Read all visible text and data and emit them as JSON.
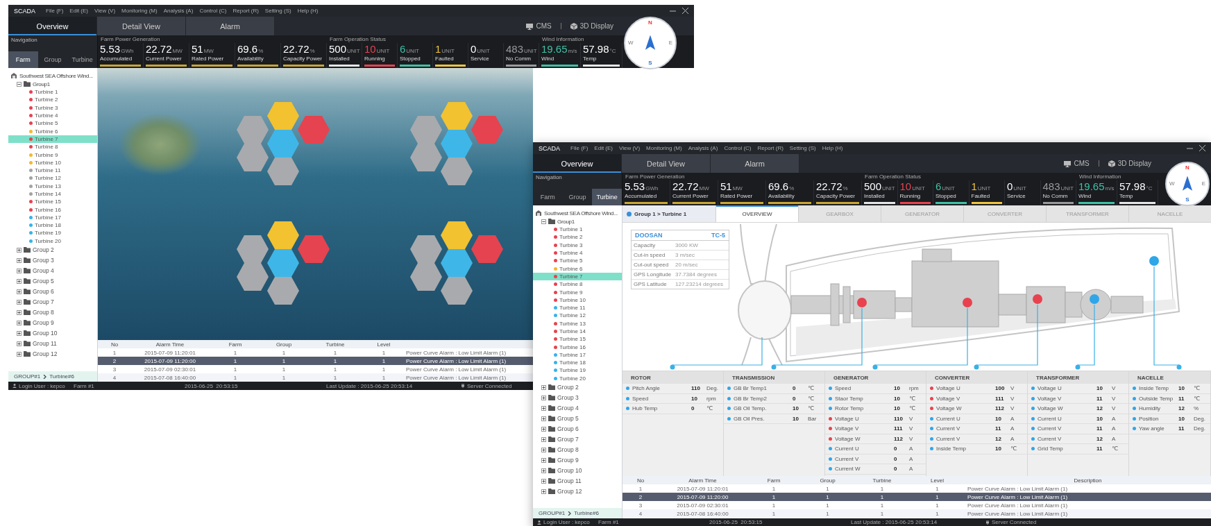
{
  "windows": [
    {
      "kind": "map",
      "title": "SCADA",
      "menu": [
        "File (F)",
        "Edit (E)",
        "View (V)",
        "Monitoring (M)",
        "Analysis (A)",
        "Control (C)",
        "Report (R)",
        "Setting (S)",
        "Help (H)"
      ],
      "tabs": [
        {
          "label": "Overview",
          "selected": true
        },
        {
          "label": "Detail View",
          "selected": false
        },
        {
          "label": "Alarm",
          "selected": false
        }
      ],
      "tools": [
        "CMS",
        "3D Display"
      ],
      "compass": {
        "n": "N",
        "e": "E",
        "s": "S",
        "w": "W"
      },
      "navigation": {
        "title": "Navigation",
        "tabs": [
          {
            "label": "Farm",
            "selected": true
          },
          {
            "label": "Group",
            "selected": false
          },
          {
            "label": "Turbine",
            "selected": false
          }
        ]
      },
      "kpi_groups": [
        {
          "title": "Farm Power Generation",
          "items": [
            {
              "value": "5.53",
              "unit": "GWh",
              "label": "Accumulated",
              "color": "#c9a634",
              "highlight": false
            },
            {
              "value": "22.72",
              "unit": "MW",
              "label": "Current Power",
              "color": "#c9a634",
              "highlight": false
            },
            {
              "value": "51",
              "unit": "MW",
              "label": "Rated Power",
              "color": "#c9a634",
              "highlight": false
            },
            {
              "value": "69.6",
              "unit": "%",
              "label": "Availability",
              "color": "#c9a634",
              "highlight": false
            },
            {
              "value": "22.72",
              "unit": "%",
              "label": "Capacity Power",
              "color": "#c9a634",
              "highlight": false
            }
          ]
        },
        {
          "title": "Farm Operation Status",
          "items": [
            {
              "value": "500",
              "unit": "UNIT",
              "label": "Installed",
              "color": "#e6e6e6",
              "highlight": false
            },
            {
              "value": "10",
              "unit": "UNIT",
              "label": "Running",
              "color": "#e8424f",
              "highlight": true
            },
            {
              "value": "6",
              "unit": "UNIT",
              "label": "Stopped",
              "color": "#3fc1a5",
              "highlight": true
            },
            {
              "value": "1",
              "unit": "UNIT",
              "label": "Faulted",
              "color": "#f0c53c",
              "highlight": true
            },
            {
              "value": "0",
              "unit": "UNIT",
              "label": "Service"
            },
            {
              "value": "483",
              "unit": "UNIT",
              "label": "No Comm",
              "color": "#9a9a9a",
              "highlight": true
            }
          ]
        },
        {
          "title": "Wind Information",
          "items": [
            {
              "value": "19.65",
              "unit": "m/s",
              "label": "Wind",
              "color": "#3fc1a5",
              "highlight": true
            },
            {
              "value": "57.98",
              "unit": "°C",
              "label": "Temp",
              "color": "#e6e6e6",
              "highlight": false
            }
          ]
        }
      ],
      "tree": {
        "label": "Southwest SEA Offshore Wind...",
        "kind": "farm",
        "selected": false,
        "children": [
          {
            "label": "Group1",
            "kind": "group",
            "expanded": true,
            "selected": false,
            "children": [
              {
                "label": "Turbine 1",
                "kind": "turbine",
                "color": "#e8424f",
                "selected": false
              },
              {
                "label": "Turbine 2",
                "kind": "turbine",
                "color": "#e8424f",
                "selected": false
              },
              {
                "label": "Turbine 3",
                "kind": "turbine",
                "color": "#e8424f",
                "selected": false
              },
              {
                "label": "Turbine 4",
                "kind": "turbine",
                "color": "#e8424f",
                "selected": false
              },
              {
                "label": "Turbine 5",
                "kind": "turbine",
                "color": "#e8424f",
                "selected": false
              },
              {
                "label": "Turbine 6",
                "kind": "turbine",
                "color": "#f5b82e",
                "selected": false
              },
              {
                "label": "Turbine 7",
                "kind": "turbine",
                "color": "#e8424f",
                "selected": true
              },
              {
                "label": "Turbine 8",
                "kind": "turbine",
                "color": "#e8424f",
                "selected": false
              },
              {
                "label": "Turbine 9",
                "kind": "turbine",
                "color": "#f5b82e",
                "selected": false
              },
              {
                "label": "Turbine 10",
                "kind": "turbine",
                "color": "#f5b82e",
                "selected": false
              },
              {
                "label": "Turbine 11",
                "kind": "turbine",
                "color": "#a3a3a3",
                "selected": false
              },
              {
                "label": "Turbine 12",
                "kind": "turbine",
                "color": "#a3a3a3",
                "selected": false
              },
              {
                "label": "Turbine 13",
                "kind": "turbine",
                "color": "#a3a3a3",
                "selected": false
              },
              {
                "label": "Turbine 14",
                "kind": "turbine",
                "color": "#a3a3a3",
                "selected": false
              },
              {
                "label": "Turbine 15",
                "kind": "turbine",
                "color": "#e8424f",
                "selected": false
              },
              {
                "label": "Turbine 16",
                "kind": "turbine",
                "color": "#e8424f",
                "selected": false
              },
              {
                "label": "Turbine 17",
                "kind": "turbine",
                "color": "#35b4ea",
                "selected": false
              },
              {
                "label": "Turbine 18",
                "kind": "turbine",
                "color": "#35b4ea",
                "selected": false
              },
              {
                "label": "Turbine 19",
                "kind": "turbine",
                "color": "#35b4ea",
                "selected": false
              },
              {
                "label": "Turbine 20",
                "kind": "turbine",
                "color": "#35b4ea",
                "selected": false
              }
            ]
          },
          {
            "label": "Group 2",
            "kind": "group",
            "expanded": false,
            "selected": false
          },
          {
            "label": "Group 3",
            "kind": "group",
            "expanded": false,
            "selected": false
          },
          {
            "label": "Group 4",
            "kind": "group",
            "expanded": false,
            "selected": false
          },
          {
            "label": "Group 5",
            "kind": "group",
            "expanded": false,
            "selected": false
          },
          {
            "label": "Group 6",
            "kind": "group",
            "expanded": false,
            "selected": false
          },
          {
            "label": "Group 7",
            "kind": "group",
            "expanded": false,
            "selected": false
          },
          {
            "label": "Group 8",
            "kind": "group",
            "expanded": false,
            "selected": false
          },
          {
            "label": "Group 9",
            "kind": "group",
            "expanded": false,
            "selected": false
          },
          {
            "label": "Group 10",
            "kind": "group",
            "expanded": false,
            "selected": false
          },
          {
            "label": "Group 11",
            "kind": "group",
            "expanded": false,
            "selected": false
          },
          {
            "label": "Group 12",
            "kind": "group",
            "expanded": false,
            "selected": false
          }
        ]
      },
      "breadcrumb": [
        "GROUP#1",
        "Turbine#6"
      ],
      "map": {
        "clusters": [
          {
            "hexes": [
              {
                "color": "#f2c230"
              },
              {
                "color": "#a9aaad"
              },
              {
                "color": "#e5434f"
              },
              {
                "color": "#3fb6e8"
              },
              {
                "color": "#a9aaad"
              },
              {
                "color": "#a9aaad"
              }
            ]
          },
          {
            "hexes": [
              {
                "color": "#f2c230"
              },
              {
                "color": "#a9aaad"
              },
              {
                "color": "#e5434f"
              },
              {
                "color": "#3fb6e8"
              },
              {
                "color": "#a9aaad"
              },
              {
                "color": "#a9aaad"
              }
            ]
          },
          {
            "hexes": [
              {
                "color": "#f2c230"
              },
              {
                "color": "#a9aaad"
              },
              {
                "color": "#e5434f"
              },
              {
                "color": "#3fb6e8"
              },
              {
                "color": "#a9aaad"
              },
              {
                "color": "#a9aaad"
              }
            ]
          },
          {
            "hexes": [
              {
                "color": "#f2c230"
              },
              {
                "color": "#a9aaad"
              },
              {
                "color": "#e5434f"
              },
              {
                "color": "#3fb6e8"
              },
              {
                "color": "#a9aaad"
              },
              {
                "color": "#a9aaad"
              }
            ]
          }
        ]
      },
      "alarms": {
        "columns": [
          "No",
          "Alarm Time",
          "Farm",
          "Group",
          "Turbine",
          "Level"
        ],
        "rows": [
          {
            "cells": [
              "1",
              "2015-07-09 11:20:01",
              "1",
              "1",
              "1",
              "1",
              "Power Curve Alarm : Low Limit Alarm (1)"
            ],
            "selected": false
          },
          {
            "cells": [
              "2",
              "2015-07-09 11:20:00",
              "1",
              "1",
              "1",
              "1",
              "Power Curve Alarm : Low Limit Alarm (1)"
            ],
            "selected": true
          },
          {
            "cells": [
              "3",
              "2015-07-09 02:30:01",
              "1",
              "1",
              "1",
              "1",
              "Power Curve Alarm : Low Limit Alarm (1)"
            ],
            "selected": false
          },
          {
            "cells": [
              "4",
              "2015-07-08 16:40:00",
              "1",
              "1",
              "1",
              "1",
              "Power Curve Alarm : Low Limit Alarm (1)"
            ],
            "selected": false
          }
        ]
      },
      "status_bar": {
        "user": "Login User : kepco",
        "farm": "Farm #1",
        "time": "2015-06-25  20:53:15",
        "last_update": "Last Update : 2015-06-25 20:53:14",
        "server": "Server Connected"
      }
    },
    {
      "kind": "detail",
      "title": "SCADA",
      "menu": [
        "File (F)",
        "Edit (E)",
        "View (V)",
        "Monitoring (M)",
        "Analysis (A)",
        "Control (C)",
        "Report (R)",
        "Setting (S)",
        "Help (H)"
      ],
      "tabs": [
        {
          "label": "Overview",
          "selected": true
        },
        {
          "label": "Detail View",
          "selected": false
        },
        {
          "label": "Alarm",
          "selected": false
        }
      ],
      "tools": [
        "CMS",
        "3D Display"
      ],
      "compass": {
        "n": "N",
        "e": "E",
        "s": "S",
        "w": "W"
      },
      "navigation": {
        "title": "Navigation",
        "tabs": [
          {
            "label": "Farm",
            "selected": false
          },
          {
            "label": "Group",
            "selected": false
          },
          {
            "label": "Turbine",
            "selected": true
          }
        ]
      },
      "kpi_groups": [
        {
          "title": "Farm Power Generation",
          "items": [
            {
              "value": "5.53",
              "unit": "GWh",
              "label": "Accumulated",
              "color": "#c9a634",
              "highlight": false
            },
            {
              "value": "22.72",
              "unit": "MW",
              "label": "Current Power",
              "color": "#c9a634",
              "highlight": false
            },
            {
              "value": "51",
              "unit": "MW",
              "label": "Rated Power",
              "color": "#c9a634",
              "highlight": false
            },
            {
              "value": "69.6",
              "unit": "%",
              "label": "Availability",
              "color": "#c9a634",
              "highlight": false
            },
            {
              "value": "22.72",
              "unit": "%",
              "label": "Capacity Power",
              "color": "#c9a634",
              "highlight": false
            }
          ]
        },
        {
          "title": "Farm Operation Status",
          "items": [
            {
              "value": "500",
              "unit": "UNIT",
              "label": "Installed",
              "color": "#e6e6e6",
              "highlight": false
            },
            {
              "value": "10",
              "unit": "UNIT",
              "label": "Running",
              "color": "#e8424f",
              "highlight": true
            },
            {
              "value": "6",
              "unit": "UNIT",
              "label": "Stopped",
              "color": "#3fc1a5",
              "highlight": true
            },
            {
              "value": "1",
              "unit": "UNIT",
              "label": "Faulted",
              "color": "#f0c53c",
              "highlight": true
            },
            {
              "value": "0",
              "unit": "UNIT",
              "label": "Service"
            },
            {
              "value": "483",
              "unit": "UNIT",
              "label": "No Comm",
              "color": "#9a9a9a",
              "highlight": true
            }
          ]
        },
        {
          "title": "Wind Information",
          "items": [
            {
              "value": "19.65",
              "unit": "m/s",
              "label": "Wind",
              "color": "#3fc1a5",
              "highlight": true
            },
            {
              "value": "57.98",
              "unit": "°C",
              "label": "Temp",
              "color": "#e6e6e6",
              "highlight": false
            }
          ]
        }
      ],
      "tree": {
        "label": "Southwest SEA Offshore Wind...",
        "kind": "farm",
        "selected": false,
        "children": [
          {
            "label": "Group1",
            "kind": "group",
            "expanded": true,
            "selected": false,
            "children": [
              {
                "label": "Turbine 1",
                "kind": "turbine",
                "color": "#e8424f",
                "selected": false
              },
              {
                "label": "Turbine 2",
                "kind": "turbine",
                "color": "#e8424f",
                "selected": false
              },
              {
                "label": "Turbine 3",
                "kind": "turbine",
                "color": "#e8424f",
                "selected": false
              },
              {
                "label": "Turbine 4",
                "kind": "turbine",
                "color": "#e8424f",
                "selected": false
              },
              {
                "label": "Turbine 5",
                "kind": "turbine",
                "color": "#e8424f",
                "selected": false
              },
              {
                "label": "Turbine 6",
                "kind": "turbine",
                "color": "#f5b82e",
                "selected": false
              },
              {
                "label": "Turbine 7",
                "kind": "turbine",
                "color": "#e8424f",
                "selected": true
              },
              {
                "label": "Turbine 8",
                "kind": "turbine",
                "color": "#e8424f",
                "selected": false
              },
              {
                "label": "Turbine 9",
                "kind": "turbine",
                "color": "#e8424f",
                "selected": false
              },
              {
                "label": "Turbine 10",
                "kind": "turbine",
                "color": "#e8424f",
                "selected": false
              },
              {
                "label": "Turbine 11",
                "kind": "turbine",
                "color": "#35b4ea",
                "selected": false
              },
              {
                "label": "Turbine 12",
                "kind": "turbine",
                "color": "#35b4ea",
                "selected": false
              },
              {
                "label": "Turbine 13",
                "kind": "turbine",
                "color": "#e8424f",
                "selected": false
              },
              {
                "label": "Turbine 14",
                "kind": "turbine",
                "color": "#e8424f",
                "selected": false
              },
              {
                "label": "Turbine 15",
                "kind": "turbine",
                "color": "#e8424f",
                "selected": false
              },
              {
                "label": "Turbine 16",
                "kind": "turbine",
                "color": "#e8424f",
                "selected": false
              },
              {
                "label": "Turbine 17",
                "kind": "turbine",
                "color": "#35b4ea",
                "selected": false
              },
              {
                "label": "Turbine 18",
                "kind": "turbine",
                "color": "#35b4ea",
                "selected": false
              },
              {
                "label": "Turbine 19",
                "kind": "turbine",
                "color": "#35b4ea",
                "selected": false
              },
              {
                "label": "Turbine 20",
                "kind": "turbine",
                "color": "#35b4ea",
                "selected": false
              }
            ]
          },
          {
            "label": "Group 2",
            "kind": "group",
            "expanded": false,
            "selected": false
          },
          {
            "label": "Group 3",
            "kind": "group",
            "expanded": false,
            "selected": false
          },
          {
            "label": "Group 4",
            "kind": "group",
            "expanded": false,
            "selected": false
          },
          {
            "label": "Group 5",
            "kind": "group",
            "expanded": false,
            "selected": false
          },
          {
            "label": "Group 6",
            "kind": "group",
            "expanded": false,
            "selected": false
          },
          {
            "label": "Group 7",
            "kind": "group",
            "expanded": false,
            "selected": false
          },
          {
            "label": "Group 8",
            "kind": "group",
            "expanded": false,
            "selected": false
          },
          {
            "label": "Group 9",
            "kind": "group",
            "expanded": false,
            "selected": false
          },
          {
            "label": "Group 10",
            "kind": "group",
            "expanded": false,
            "selected": false
          },
          {
            "label": "Group 11",
            "kind": "group",
            "expanded": false,
            "selected": false
          },
          {
            "label": "Group 12",
            "kind": "group",
            "expanded": false,
            "selected": false
          }
        ]
      },
      "breadcrumb": [
        "GROUP#1",
        "Turbine#6"
      ],
      "detail": {
        "path": "Group 1 > Turbine 1",
        "tabs": [
          {
            "label": "OVERVIEW",
            "selected": true
          },
          {
            "label": "GEARBOX",
            "selected": false
          },
          {
            "label": "GENERATOR",
            "selected": false
          },
          {
            "label": "CONVERTER",
            "selected": false
          },
          {
            "label": "TRANSFORMER",
            "selected": false
          },
          {
            "label": "NACELLE",
            "selected": false
          }
        ],
        "spec": {
          "brand": "DOOSAN",
          "model": "TC-5",
          "rows": [
            {
              "label": "Capacity",
              "value": "3000 KW"
            },
            {
              "label": "Cut-in speed",
              "value": "3 m/sec"
            },
            {
              "label": "Cut-out speed",
              "value": "20 m/sec"
            },
            {
              "label": "GPS Longitude",
              "value": "37.7384 degrees"
            },
            {
              "label": "GPS Latitude",
              "value": "127.23214 degrees"
            }
          ]
        },
        "drawing_markers": [
          {
            "color": "#e8424f"
          },
          {
            "color": "#e8424f"
          },
          {
            "color": "#e8424f"
          },
          {
            "color": "#2fa6e8"
          },
          {
            "color": "#2fa6e8"
          }
        ],
        "sections": [
          {
            "title": "ROTOR",
            "rows": [
              {
                "label": "Pitch Angle",
                "value": "110",
                "unit": "Deg.",
                "color": "#2fa6e8"
              },
              {
                "label": "Speed",
                "value": "10",
                "unit": "rpm",
                "color": "#2fa6e8"
              },
              {
                "label": "Hub Temp",
                "value": "0",
                "unit": "℃",
                "color": "#2fa6e8"
              }
            ]
          },
          {
            "title": "TRANSMISSION",
            "rows": [
              {
                "label": "GB Br Temp1",
                "value": "0",
                "unit": "℃",
                "color": "#2fa6e8"
              },
              {
                "label": "GB Br Temp2",
                "value": "0",
                "unit": "℃",
                "color": "#2fa6e8"
              },
              {
                "label": "GB Oil Temp.",
                "value": "10",
                "unit": "℃",
                "color": "#2fa6e8"
              },
              {
                "label": "GB Oil Pres.",
                "value": "10",
                "unit": "Bar",
                "color": "#2fa6e8"
              }
            ]
          },
          {
            "title": "GENERATOR",
            "rows": [
              {
                "label": "Speed",
                "value": "10",
                "unit": "rpm",
                "color": "#2fa6e8"
              },
              {
                "label": "Staor Temp",
                "value": "10",
                "unit": "℃",
                "color": "#2fa6e8"
              },
              {
                "label": "Rotor Temp",
                "value": "10",
                "unit": "℃",
                "color": "#2fa6e8"
              },
              {
                "label": "Voltage U",
                "value": "110",
                "unit": "V",
                "color": "#e8424f"
              },
              {
                "label": "Voltage V",
                "value": "111",
                "unit": "V",
                "color": "#e8424f"
              },
              {
                "label": "Voltage W",
                "value": "112",
                "unit": "V",
                "color": "#e8424f"
              },
              {
                "label": "Current U",
                "value": "0",
                "unit": "A",
                "color": "#2fa6e8"
              },
              {
                "label": "Current V",
                "value": "0",
                "unit": "A",
                "color": "#2fa6e8"
              },
              {
                "label": "Current W",
                "value": "0",
                "unit": "A",
                "color": "#2fa6e8"
              }
            ]
          },
          {
            "title": "CONVERTER",
            "rows": [
              {
                "label": "Voltage U",
                "value": "100",
                "unit": "V",
                "color": "#e8424f"
              },
              {
                "label": "Voltage V",
                "value": "111",
                "unit": "V",
                "color": "#e8424f"
              },
              {
                "label": "Voltage W",
                "value": "112",
                "unit": "V",
                "color": "#e8424f"
              },
              {
                "label": "Current U",
                "value": "10",
                "unit": "A",
                "color": "#2fa6e8"
              },
              {
                "label": "Current V",
                "value": "11",
                "unit": "A",
                "color": "#2fa6e8"
              },
              {
                "label": "Current V",
                "value": "12",
                "unit": "A",
                "color": "#2fa6e8"
              },
              {
                "label": "Inside Temp",
                "value": "10",
                "unit": "℃",
                "color": "#2fa6e8"
              }
            ]
          },
          {
            "title": "TRANSFORMER",
            "rows": [
              {
                "label": "Voltage U",
                "value": "10",
                "unit": "V",
                "color": "#2fa6e8"
              },
              {
                "label": "Voltage V",
                "value": "11",
                "unit": "V",
                "color": "#2fa6e8"
              },
              {
                "label": "Voltage W",
                "value": "12",
                "unit": "V",
                "color": "#2fa6e8"
              },
              {
                "label": "Current U",
                "value": "10",
                "unit": "A",
                "color": "#2fa6e8"
              },
              {
                "label": "Current V",
                "value": "11",
                "unit": "A",
                "color": "#2fa6e8"
              },
              {
                "label": "Current V",
                "value": "12",
                "unit": "A",
                "color": "#2fa6e8"
              },
              {
                "label": "Grid Temp",
                "value": "11",
                "unit": "℃",
                "color": "#2fa6e8"
              }
            ]
          },
          {
            "title": "NACELLE",
            "rows": [
              {
                "label": "Inside Temp",
                "value": "10",
                "unit": "℃",
                "color": "#2fa6e8"
              },
              {
                "label": "Outside Temp",
                "value": "11",
                "unit": "℃",
                "color": "#2fa6e8"
              },
              {
                "label": "Humidity",
                "value": "12",
                "unit": "%",
                "color": "#2fa6e8"
              },
              {
                "label": "Position",
                "value": "10",
                "unit": "Deg.",
                "color": "#2fa6e8"
              },
              {
                "label": "Yaw angle",
                "value": "11",
                "unit": "Deg.",
                "color": "#2fa6e8"
              }
            ]
          }
        ]
      },
      "alarms": {
        "columns": [
          "No",
          "Alarm Time",
          "Farm",
          "Group",
          "Turbine",
          "Level",
          "Description"
        ],
        "rows": [
          {
            "cells": [
              "1",
              "2015-07-09 11:20:01",
              "1",
              "1",
              "1",
              "1",
              "Power Curve Alarm : Low Limit Alarm (1)"
            ],
            "selected": false
          },
          {
            "cells": [
              "2",
              "2015-07-09 11:20:00",
              "1",
              "1",
              "1",
              "1",
              "Power Curve Alarm : Low Limit Alarm (1)"
            ],
            "selected": true
          },
          {
            "cells": [
              "3",
              "2015-07-09 02:30:01",
              "1",
              "1",
              "1",
              "1",
              "Power Curve Alarm : Low Limit Alarm (1)"
            ],
            "selected": false
          },
          {
            "cells": [
              "4",
              "2015-07-08 16:40:00",
              "1",
              "1",
              "1",
              "1",
              "Power Curve Alarm : Low Limit Alarm (1)"
            ],
            "selected": false
          }
        ]
      },
      "status_bar": {
        "user": "Login User : kepco",
        "farm": "Farm #1",
        "time": "2015-06-25  20:53:15",
        "last_update": "Last Update : 2015-06-25 20:53:14",
        "server": "Server Connected"
      }
    }
  ]
}
